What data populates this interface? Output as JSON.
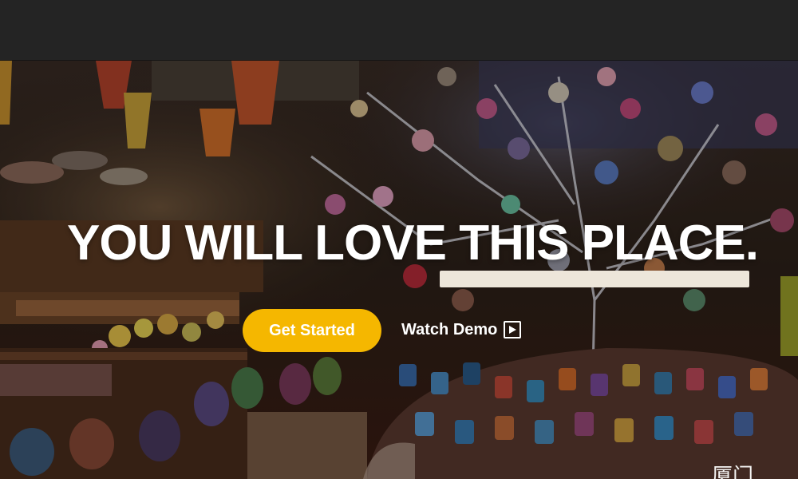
{
  "header": {},
  "hero": {
    "background_image": "market-stall-handicrafts-photo",
    "headline": "YOU WILL LOVE THIS PLACE.",
    "subtitle_text": "",
    "cta_label": "Get Started",
    "watch_label": "Watch Demo",
    "watch_icon": "play-icon",
    "corner_text": "厦门"
  },
  "colors": {
    "topbar": "#242424",
    "cta": "#f5b700",
    "subtitle_bar": "#ede6da",
    "text": "#ffffff"
  }
}
